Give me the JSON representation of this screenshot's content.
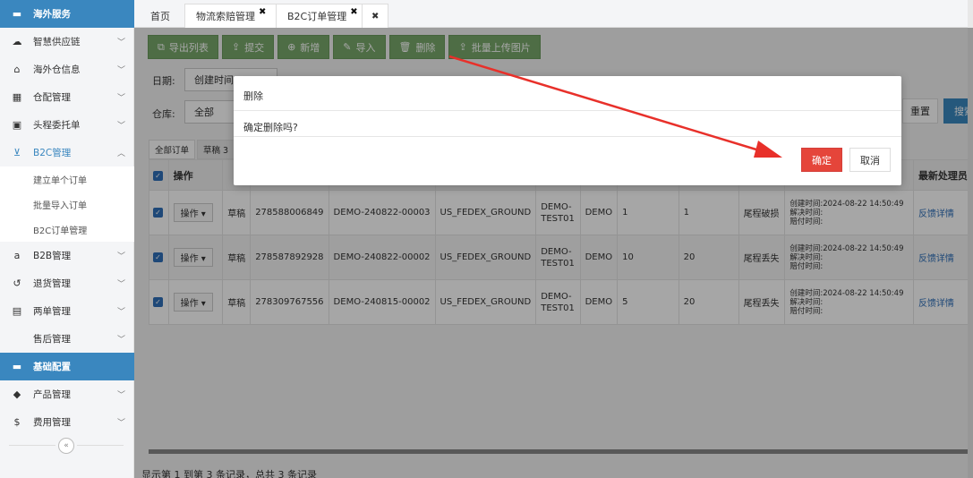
{
  "sidebar": {
    "items": [
      {
        "label": "海外服务",
        "icon": "folder-icon"
      },
      {
        "label": "智慧供应链",
        "icon": "cloud-icon"
      },
      {
        "label": "海外仓信息",
        "icon": "home-icon"
      },
      {
        "label": "仓配管理",
        "icon": "grid-icon"
      },
      {
        "label": "头程委托单",
        "icon": "briefcase-icon"
      },
      {
        "label": "B2C管理",
        "icon": "cart-icon"
      },
      {
        "label": "B2B管理",
        "icon": "amazon-icon"
      },
      {
        "label": "退货管理",
        "icon": "undo-icon"
      },
      {
        "label": "两单管理",
        "icon": "document-icon"
      },
      {
        "label": "售后管理",
        "icon": ""
      },
      {
        "label": "基础配置",
        "icon": "folder-icon"
      },
      {
        "label": "产品管理",
        "icon": "tag-icon"
      },
      {
        "label": "费用管理",
        "icon": "dollar-icon"
      }
    ],
    "b2c_sub": [
      "建立单个订单",
      "批量导入订单",
      "B2C订单管理"
    ],
    "collapse_glyph": "«"
  },
  "tabs": [
    {
      "label": "首页"
    },
    {
      "label": "物流索赔管理"
    },
    {
      "label": "B2C订单管理"
    }
  ],
  "toolbar": {
    "buttons": [
      "导出列表",
      "提交",
      "新增",
      "导入",
      "删除",
      "批量上传图片"
    ]
  },
  "filters": {
    "date_label": "日期:",
    "date_value": "创建时间",
    "warehouse_label": "仓库:",
    "warehouse_value": "全部",
    "reset_label": "重置",
    "search_label": "搜索"
  },
  "subtabs": [
    "全部订单",
    "草稿 3"
  ],
  "table": {
    "headers": [
      "操作",
      "",
      "",
      "",
      "",
      "",
      "",
      "",
      "",
      "",
      "",
      "最新处理员"
    ],
    "rows": [
      {
        "op": "操作",
        "status": "草稿",
        "tracking": "278588006849",
        "order": "DEMO-240822-00003",
        "service": "US_FEDEX_GROUND",
        "warehouse": "DEMO-TEST01",
        "customer": "DEMO",
        "qty": "1",
        "amount": "1",
        "type": "尾程破损",
        "created": "创建时间:2024-08-22 14:50:49",
        "resolved": "解决时间:",
        "paid": "赔付时间:",
        "link": "反馈详情"
      },
      {
        "op": "操作",
        "status": "草稿",
        "tracking": "278587892928",
        "order": "DEMO-240822-00002",
        "service": "US_FEDEX_GROUND",
        "warehouse": "DEMO-TEST01",
        "customer": "DEMO",
        "qty": "10",
        "amount": "20",
        "type": "尾程丢失",
        "created": "创建时间:2024-08-22 14:50:49",
        "resolved": "解决时间:",
        "paid": "赔付时间:",
        "link": "反馈详情"
      },
      {
        "op": "操作",
        "status": "草稿",
        "tracking": "278309767556",
        "order": "DEMO-240815-00002",
        "service": "US_FEDEX_GROUND",
        "warehouse": "DEMO-TEST01",
        "customer": "DEMO",
        "qty": "5",
        "amount": "20",
        "type": "尾程丢失",
        "created": "创建时间:2024-08-22 14:50:49",
        "resolved": "解决时间:",
        "paid": "赔付时间:",
        "link": "反馈详情"
      }
    ]
  },
  "footer": "显示第 1 到第 3 条记录，总共 3 条记录",
  "modal": {
    "title": "删除",
    "message": "确定删除吗?",
    "ok_label": "确定",
    "cancel_label": "取消"
  },
  "colors": {
    "accent": "#3a87bf",
    "toolbar_green": "#78a86a",
    "danger": "#e5453a",
    "arrow": "#e8302a"
  }
}
